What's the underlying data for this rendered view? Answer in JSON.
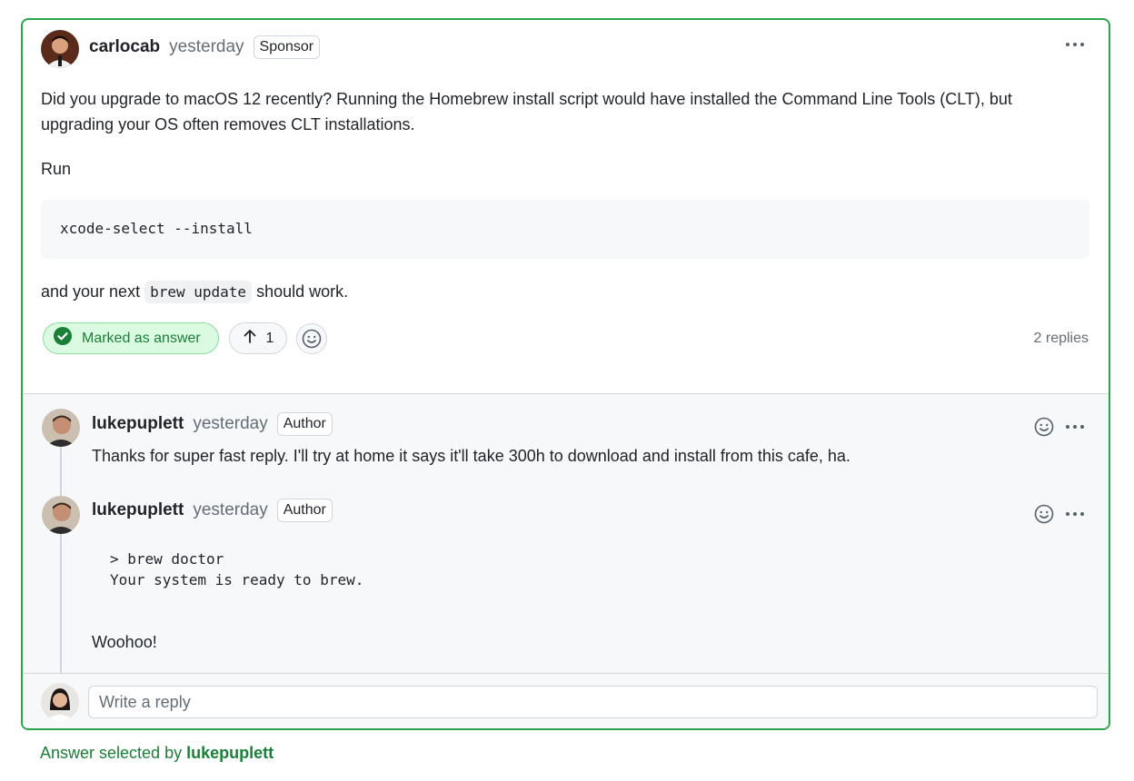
{
  "main_comment": {
    "author": "carlocab",
    "time": "yesterday",
    "badge": "Sponsor",
    "paragraph1": "Did you upgrade to macOS 12 recently? Running the Homebrew install script would have installed the Command Line Tools (CLT), but upgrading your OS often removes CLT installations.",
    "paragraph2": "Run",
    "code": "xcode-select --install",
    "paragraph3_before": "and your next",
    "paragraph3_code": "brew update",
    "paragraph3_after": "should work.",
    "answer_label": "Marked as answer",
    "upvotes": "1",
    "replies_count": "2 replies"
  },
  "replies": [
    {
      "author": "lukepuplett",
      "time": "yesterday",
      "badge": "Author",
      "text": "Thanks for super fast reply. I'll try at home it says it'll take 300h to download and install from this cafe, ha."
    },
    {
      "author": "lukepuplett",
      "time": "yesterday",
      "badge": "Author",
      "code": "> brew doctor\nYour system is ready to brew.",
      "text": "Woohoo!"
    }
  ],
  "composer": {
    "placeholder": "Write a reply"
  },
  "footer": {
    "prefix": "Answer selected by",
    "user": "lukepuplett"
  },
  "colors": {
    "accent_green": "#2da44e",
    "answer_bg": "#dafbe1",
    "text_muted": "#656d76"
  },
  "icons": [
    "kebab-icon",
    "check-circle-icon",
    "arrow-up-icon",
    "smiley-icon"
  ]
}
